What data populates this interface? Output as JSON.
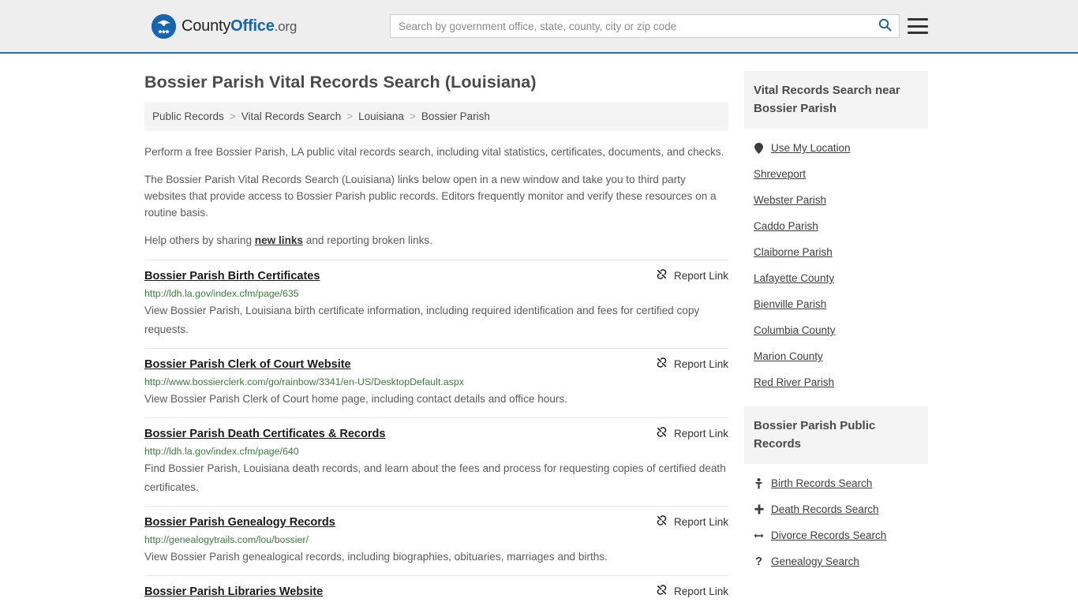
{
  "header": {
    "logo": {
      "part1": "County",
      "part2": "Office",
      "part3": ".org",
      "icon": "eagle-seal-icon"
    },
    "search": {
      "placeholder": "Search by government office, state, county, city or zip code",
      "value": "",
      "icon": "search-icon"
    },
    "menu_icon": "hamburger-menu-icon"
  },
  "page": {
    "title": "Bossier Parish Vital Records Search (Louisiana)"
  },
  "breadcrumb": {
    "items": [
      "Public Records",
      "Vital Records Search",
      "Louisiana",
      "Bossier Parish"
    ],
    "separator": ">"
  },
  "intro": {
    "p1": "Perform a free Bossier Parish, LA public vital records search, including vital statistics, certificates, documents, and checks.",
    "p2": "The Bossier Parish Vital Records Search (Louisiana) links below open in a new window and take you to third party websites that provide access to Bossier Parish public records. Editors frequently monitor and verify these resources on a routine basis.",
    "p3_before": "Help others by sharing ",
    "p3_link": "new links",
    "p3_after": " and reporting broken links."
  },
  "report_link_label": "Report Link",
  "report_link_icon": "broken-link-icon",
  "results": [
    {
      "title": "Bossier Parish Birth Certificates",
      "url": "http://ldh.la.gov/index.cfm/page/635",
      "desc": "View Bossier Parish, Louisiana birth certificate information, including required identification and fees for certified copy requests."
    },
    {
      "title": "Bossier Parish Clerk of Court Website",
      "url": "http://www.bossierclerk.com/go/rainbow/3341/en-US/DesktopDefault.aspx",
      "desc": "View Bossier Parish Clerk of Court home page, including contact details and office hours."
    },
    {
      "title": "Bossier Parish Death Certificates & Records",
      "url": "http://ldh.la.gov/index.cfm/page/640",
      "desc": "Find Bossier Parish, Louisiana death records, and learn about the fees and process for requesting copies of certified death certificates."
    },
    {
      "title": "Bossier Parish Genealogy Records",
      "url": "http://genealogytrails.com/lou/bossier/",
      "desc": "View Bossier Parish genealogical records, including biographies, obituaries, marriages and births."
    },
    {
      "title": "Bossier Parish Libraries Website",
      "url": "",
      "desc": ""
    }
  ],
  "sidebar": {
    "nearby": {
      "heading": "Vital Records Search near Bossier Parish",
      "items": [
        {
          "label": "Use My Location",
          "icon": "map-pin-icon"
        },
        {
          "label": "Shreveport",
          "icon": ""
        },
        {
          "label": "Webster Parish",
          "icon": ""
        },
        {
          "label": "Caddo Parish",
          "icon": ""
        },
        {
          "label": "Claiborne Parish",
          "icon": ""
        },
        {
          "label": "Lafayette County",
          "icon": ""
        },
        {
          "label": "Bienville Parish",
          "icon": ""
        },
        {
          "label": "Columbia County",
          "icon": ""
        },
        {
          "label": "Marion County",
          "icon": ""
        },
        {
          "label": "Red River Parish",
          "icon": ""
        }
      ]
    },
    "public_records": {
      "heading": "Bossier Parish Public Records",
      "items": [
        {
          "label": "Birth Records Search",
          "icon": "baby-icon"
        },
        {
          "label": "Death Records Search",
          "icon": "cross-icon"
        },
        {
          "label": "Divorce Records Search",
          "icon": "left-right-arrow-icon"
        },
        {
          "label": "Genealogy Search",
          "icon": "question-mark-icon"
        }
      ]
    }
  },
  "colors": {
    "brand_blue": "#1565b0",
    "header_bg": "#eeeeee",
    "url_green": "#3b7a3b",
    "panel_gray": "#f4f4f4"
  }
}
